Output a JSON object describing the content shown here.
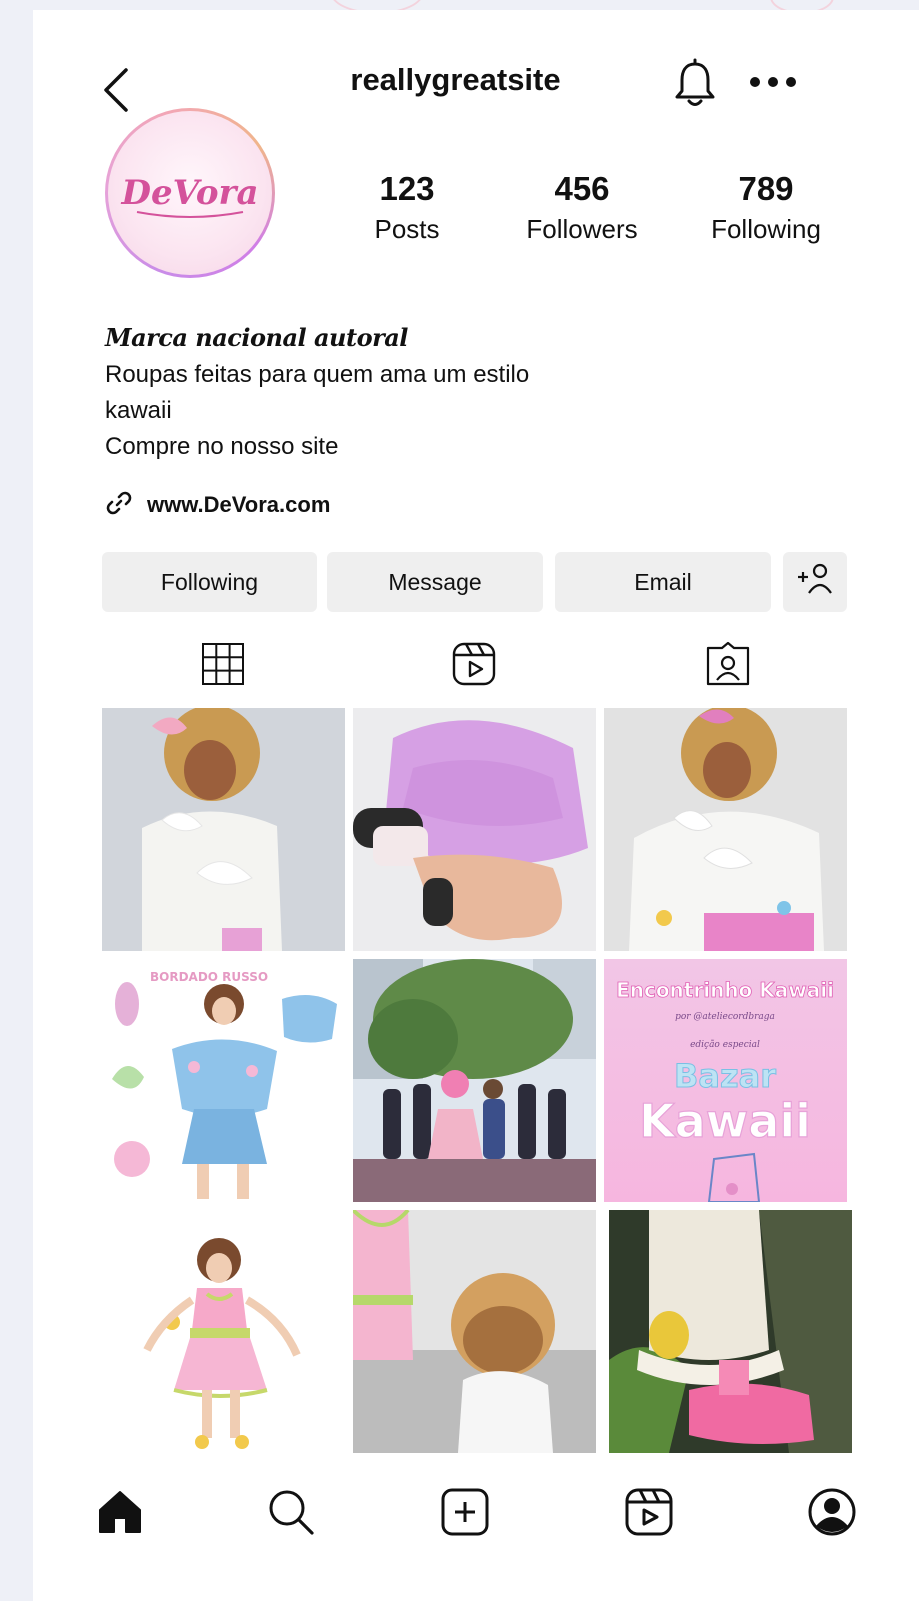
{
  "profile": {
    "username": "reallygreatsite",
    "avatar_text": "DeVora",
    "stats": [
      {
        "value": "123",
        "label": "Posts"
      },
      {
        "value": "456",
        "label": "Followers"
      },
      {
        "value": "789",
        "label": "Following"
      }
    ],
    "bio": {
      "title": "Marca nacional autoral",
      "line1": "Roupas feitas para quem ama um estilo",
      "line2": "kawaii",
      "line3": "Compre no nosso site"
    },
    "link": "www.DeVora.com"
  },
  "actions": {
    "following_label": "Following",
    "message_label": "Message",
    "email_label": "Email",
    "add_user_icon": "add-user-icon"
  },
  "tabs": [
    "grid-icon",
    "reels-icon",
    "tagged-icon"
  ],
  "posts": {
    "tile4_text": "BORDADO RUSSO",
    "tile6_title": "Encontrinho Kawaii",
    "tile6_sub": "por @ateliecordbraga",
    "tile6_edition": "edição especial",
    "tile6_word1": "Bazar",
    "tile6_word2": "Kawaii"
  },
  "nav": [
    "home-icon",
    "search-icon",
    "create-icon",
    "reels-icon",
    "profile-icon"
  ],
  "colors": {
    "accent_pink": "#e889e6",
    "button_bg": "#efefef",
    "text": "#111111"
  }
}
